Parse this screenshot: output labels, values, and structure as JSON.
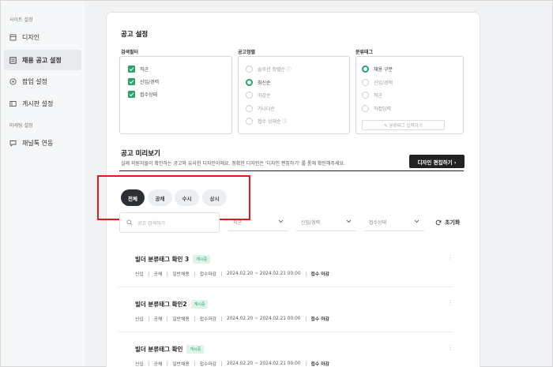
{
  "sidebar": {
    "section_site": "사이트 설정",
    "section_marketing": "마케팅 설정",
    "items": [
      {
        "label": "디자인",
        "icon": "document-icon"
      },
      {
        "label": "채용 공고 설정",
        "icon": "list-icon",
        "active": true
      },
      {
        "label": "팝업 설정",
        "icon": "popup-icon"
      },
      {
        "label": "게시판 설정",
        "icon": "board-icon"
      },
      {
        "label": "채널톡 연동",
        "icon": "chat-icon"
      }
    ]
  },
  "settings": {
    "title": "공고 설정",
    "search_filter": {
      "label": "검색필터",
      "options": [
        "직군",
        "신입/경력",
        "접수상태"
      ]
    },
    "sort": {
      "label": "공고정렬",
      "options": [
        "솔루션 정렬순 ⓘ",
        "최신순",
        "마감순",
        "가나다순",
        "접수 상태순 ⓘ"
      ],
      "selected_index": 1
    },
    "classtag": {
      "label": "분류태그",
      "options": [
        "채용 구분",
        "신입/경력",
        "직군",
        "직접입력"
      ],
      "selected_index": 0,
      "input_button": "✎ 분류태그 입력하기"
    }
  },
  "preview": {
    "title": "공고 미리보기",
    "description": "실제 지원자들이 확인하는 공고와 유사한 디자인이에요. 정확한 디자인은 '디자인 편집하기' 를 통해 확인해주세요.",
    "design_button": "디자인 편집하기 ›",
    "tabs": [
      "전체",
      "공채",
      "수시",
      "상시"
    ],
    "active_tab": 0,
    "search_placeholder": "공고 검색하기",
    "filters": [
      "직군",
      "신입/경력",
      "접수상태"
    ],
    "reset_label": "초기화"
  },
  "jobs": [
    {
      "title": "빌더 분류태그 확인 3",
      "badge": "게시중",
      "meta": [
        "신입",
        "공채",
        "일반채용",
        "접수마감",
        "2024.02.20 ~ 2024.02.21 00:00",
        "접수 마감"
      ]
    },
    {
      "title": "빌더 분류태그 확인2",
      "badge": "게시중",
      "meta": [
        "신입",
        "공채",
        "일반채용",
        "접수마감",
        "2024.02.20 ~ 2024.02.21 00:00",
        "접수 마감"
      ]
    },
    {
      "title": "빌더 분류태그 확인",
      "badge": "게시중",
      "meta": [
        "신입",
        "공채",
        "일반채용",
        "접수마감",
        "2024.02.20 ~ 2024.02.21 00:00",
        "접수 마감"
      ]
    }
  ],
  "colors": {
    "accent": "#27a46c",
    "highlight": "#e01b1b",
    "dark": "#222222"
  }
}
